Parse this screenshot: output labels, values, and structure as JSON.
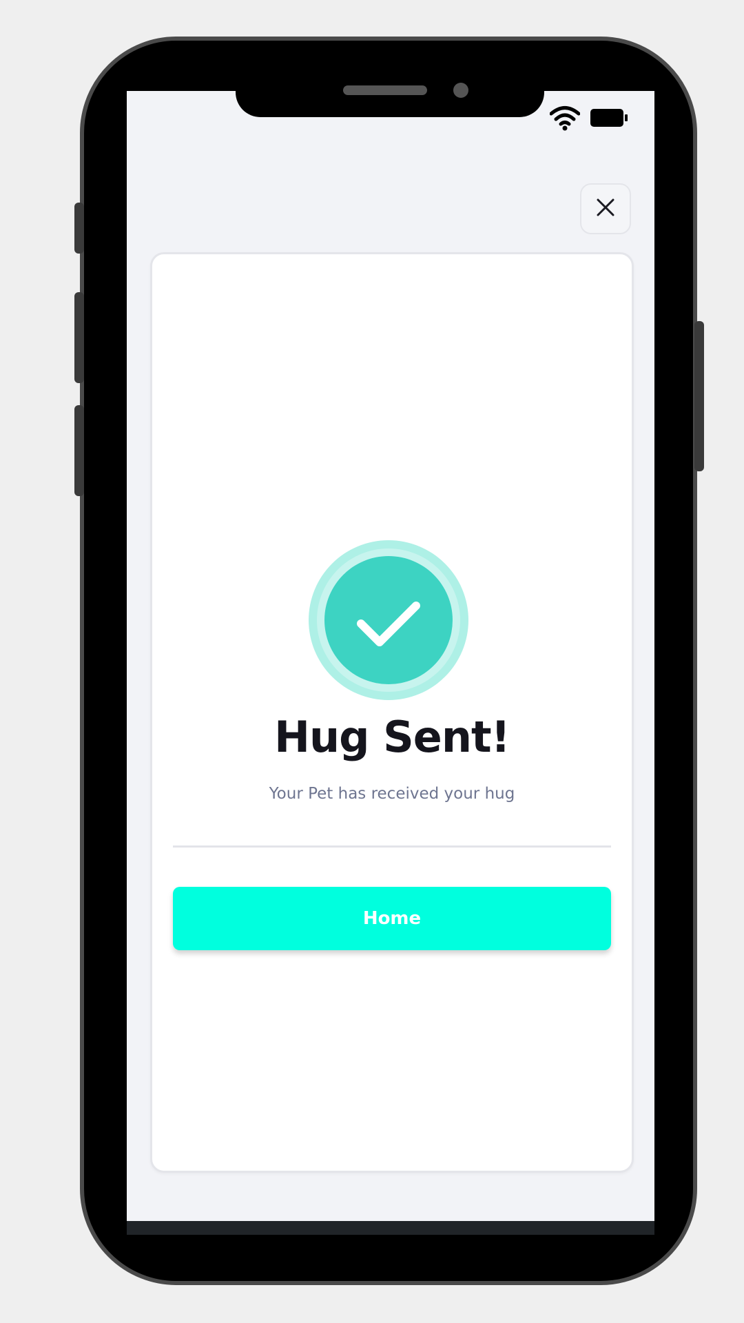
{
  "status_bar": {
    "wifi_icon": "wifi-icon",
    "battery_icon": "battery-icon"
  },
  "modal": {
    "close_icon": "close-icon",
    "success_icon": "checkmark-circle-icon",
    "title": "Hug Sent!",
    "subtitle": "Your Pet has received your hug",
    "button_label": "Home"
  },
  "colors": {
    "accent": "#00ffde",
    "success_inner": "#3dd3c2",
    "success_ring": "#aef0e6",
    "title": "#15151d",
    "subtitle": "#6e7590"
  }
}
